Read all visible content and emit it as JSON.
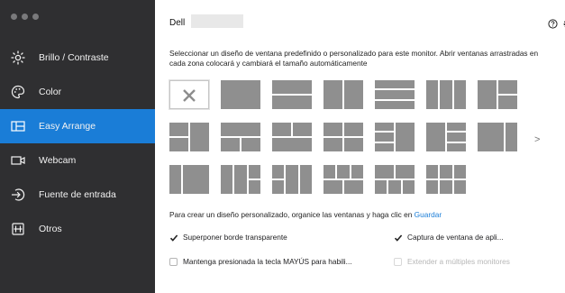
{
  "sidebar": {
    "items": [
      {
        "label": "Brillo / Contraste",
        "icon": "brightness-icon"
      },
      {
        "label": "Color",
        "icon": "palette-icon"
      },
      {
        "label": "Easy Arrange",
        "icon": "layout-icon",
        "active": true
      },
      {
        "label": "Webcam",
        "icon": "webcam-icon"
      },
      {
        "label": "Fuente de entrada",
        "icon": "input-icon"
      },
      {
        "label": "Otros",
        "icon": "other-icon"
      }
    ]
  },
  "header": {
    "brand": "Dell",
    "icons": [
      "help-icon",
      "settings-icon"
    ]
  },
  "main": {
    "description": "Seleccionar un diseño de ventana predefinido o personalizado para este monitor.  Abrir ventanas arrastradas en cada zona colocará y cambiará el tamaño automáticamente",
    "custom_note_prefix": "Para crear un diseño personalizado, organice las ventanas y haga clic en ",
    "custom_note_link": "Guardar",
    "more_arrow": ">",
    "options": [
      {
        "label": "Superponer borde transparente",
        "checked": true,
        "enabled": true
      },
      {
        "label": "Captura de ventana de apli...",
        "checked": true,
        "enabled": true
      },
      {
        "label": "Mantenga presionada la tecla MAYÚS para habili...",
        "checked": false,
        "enabled": true
      },
      {
        "label": "Extender a múltiples monitores",
        "checked": false,
        "enabled": false
      }
    ]
  },
  "colors": {
    "sidebar_bg": "#2f2f31",
    "accent": "#1a7dd7",
    "tile": "#8f8f8f"
  }
}
